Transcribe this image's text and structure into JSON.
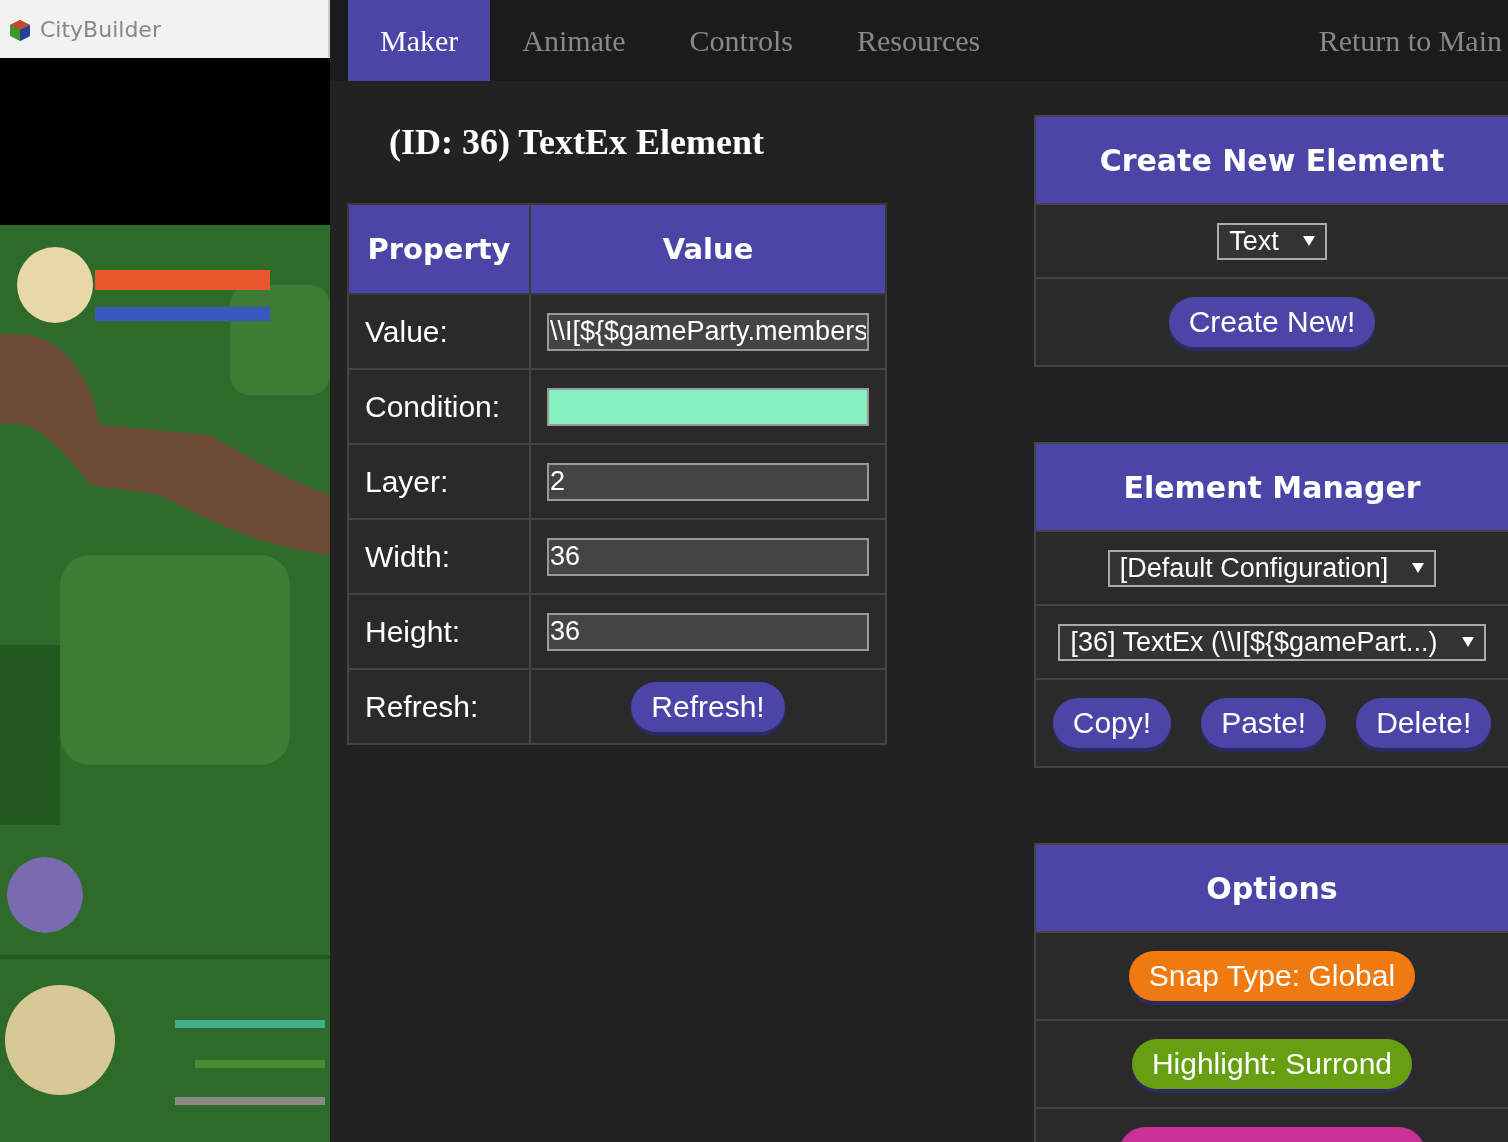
{
  "window": {
    "title": "CityBuilder"
  },
  "tabs": [
    {
      "label": "Maker",
      "selected": true
    },
    {
      "label": "Animate",
      "selected": false
    },
    {
      "label": "Controls",
      "selected": false
    },
    {
      "label": "Resources",
      "selected": false
    }
  ],
  "nav_link": "Return to Main",
  "editor": {
    "title": "(ID: 36) TextEx Element",
    "columns": [
      "Property",
      "Value"
    ],
    "rows": [
      {
        "label": "Value:",
        "kind": "field",
        "value": "\\\\I[${$gameParty.members"
      },
      {
        "label": "Condition:",
        "kind": "field",
        "valid": true
      },
      {
        "label": "Layer:",
        "kind": "field",
        "value": "2"
      },
      {
        "label": "Width:",
        "kind": "field",
        "value": "36"
      },
      {
        "label": "Height:",
        "kind": "field",
        "value": "36"
      },
      {
        "label": "Refresh:",
        "kind": "button",
        "button": "Refresh!"
      }
    ]
  },
  "panels": [
    {
      "title": "Create New Element",
      "rows": [
        {
          "kind": "select",
          "value": "Text"
        },
        {
          "kind": "buttons",
          "buttons": [
            {
              "label": "Create New!",
              "color": "#4b45a8"
            }
          ]
        }
      ]
    },
    {
      "title": "Element Manager",
      "rows": [
        {
          "kind": "select",
          "value": "[Default Configuration]"
        },
        {
          "kind": "select",
          "value": "[36] TextEx (\\\\I[${$gamePart...)"
        },
        {
          "kind": "buttons",
          "buttons": [
            {
              "label": "Copy!",
              "color": "#4b45a8"
            },
            {
              "label": "Paste!",
              "color": "#4b45a8"
            },
            {
              "label": "Delete!",
              "color": "#4b45a8"
            }
          ]
        }
      ]
    },
    {
      "title": "Options",
      "rows": [
        {
          "kind": "buttons",
          "buttons": [
            {
              "label": "Snap Type: Global",
              "color": "#ef7a10"
            }
          ]
        },
        {
          "kind": "buttons",
          "buttons": [
            {
              "label": "Highlight: Surrond",
              "color": "#66a012"
            }
          ]
        },
        {
          "kind": "buttons",
          "buttons": [
            {
              "color": "#c83296"
            }
          ]
        }
      ]
    }
  ]
}
